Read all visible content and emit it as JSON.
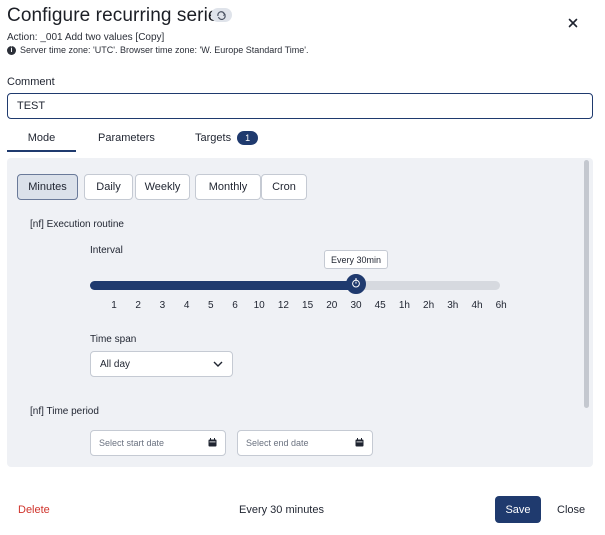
{
  "dialog": {
    "title": "Configure recurring series",
    "action_line": "Action: _001 Add two values [Copy]",
    "timezone_line": "Server time zone: 'UTC'. Browser time zone: 'W. Europe Standard Time'."
  },
  "comment": {
    "label": "Comment",
    "value": "TEST"
  },
  "tabs": [
    {
      "label": "Mode",
      "active": true
    },
    {
      "label": "Parameters",
      "active": false
    },
    {
      "label": "Targets",
      "active": false,
      "badge": "1"
    }
  ],
  "modes": [
    {
      "label": "Minutes",
      "selected": true
    },
    {
      "label": "Daily",
      "selected": false
    },
    {
      "label": "Weekly",
      "selected": false
    },
    {
      "label": "Monthly",
      "selected": false
    },
    {
      "label": "Cron",
      "selected": false
    }
  ],
  "execution": {
    "section_label": "[nf] Execution routine",
    "interval_label": "Interval",
    "ticks": [
      "1",
      "2",
      "3",
      "4",
      "5",
      "6",
      "10",
      "12",
      "15",
      "20",
      "30",
      "45",
      "1h",
      "2h",
      "3h",
      "4h",
      "6h"
    ],
    "selected_tick": "30",
    "tooltip": "Every 30min",
    "timespan_label": "Time span",
    "timespan_value": "All day"
  },
  "time_period": {
    "section_label": "[nf] Time period",
    "start_placeholder": "Select start date",
    "end_placeholder": "Select end date"
  },
  "footer": {
    "delete_label": "Delete",
    "summary": "Every 30 minutes",
    "save_label": "Save",
    "close_label": "Close"
  },
  "colors": {
    "primary": "#1f3a6e",
    "danger": "#d0342c",
    "panel_bg": "#eff1f5"
  },
  "icons": {
    "title_badge": "repeat-icon",
    "close": "close-icon",
    "info": "info-icon",
    "slider_thumb": "stopwatch-icon",
    "select": "chevron-down-icon",
    "date": "calendar-icon"
  }
}
